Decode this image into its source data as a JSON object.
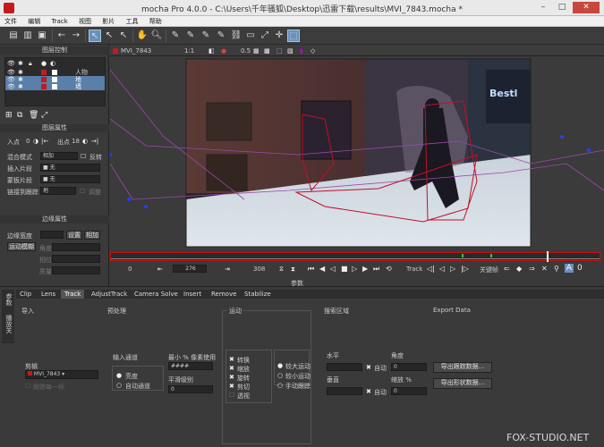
{
  "window": {
    "title": "mocha Pro 4.0.0 - C:\\Users\\千年骚狐\\Desktop\\迅雷下载\\results\\MVI_7843.mocha *"
  },
  "menu": [
    "文件",
    "编辑",
    "Track",
    "视图",
    "影片",
    "工具",
    "帮助"
  ],
  "layers_panel": {
    "title": "图层控制",
    "layers": [
      {
        "name": "人物"
      },
      {
        "name": "地"
      },
      {
        "name": "墙"
      }
    ]
  },
  "layer_props": {
    "title": "图层属性",
    "in_label": "入点",
    "in_value": "0",
    "out_label": "出点",
    "out_value": "18",
    "blend_label": "混合模式",
    "blend_value": "相加",
    "invert_label": "反转",
    "insert_clip_label": "插入片段",
    "insert_clip_value": "无",
    "matte_clip_label": "蒙板片段",
    "matte_clip_value": "无",
    "link_track_label": "链接到跟踪",
    "link_track_value": "地",
    "link_extra": "调整"
  },
  "edge_props": {
    "title": "边缘属性",
    "edge_width_label": "边缘宽度",
    "set_label": "设置",
    "add_label": "相加",
    "motion_blur_label": "运动模糊",
    "angle_label": "角度",
    "phase_label": "相位",
    "quality_label": "质量"
  },
  "viewer": {
    "clip_name": "MVI_7843",
    "zoom": "1:1",
    "alpha": "0.5"
  },
  "timeline": {
    "start": "0",
    "current": "276",
    "end": "308",
    "track_label": "Track",
    "keyframe_label": "关键帧",
    "params_label": "参数"
  },
  "tabs": [
    "Clip",
    "Lens",
    "Track",
    "AdjustTrack",
    "Camera Solve",
    "Insert",
    "Remove",
    "Stabilize"
  ],
  "active_tab": "Track",
  "side_tabs": [
    "参数",
    "播放关"
  ],
  "track_panel": {
    "input_title": "导入",
    "clip_label": "剪辑",
    "clip_value": "MVI_7843",
    "track_each_frame": "跟踪每一帧",
    "preprocess_title": "预处理",
    "input_channel_label": "输入通道",
    "luminance": "亮度",
    "auto_channel": "自动通道",
    "min_pixels_label": "最小 % 像素使用",
    "min_pixels_value": "####",
    "smooth_label": "平滑级别",
    "smooth_value": "0",
    "motion_title": "运动",
    "motion_items": [
      "转换",
      "缩放",
      "旋转",
      "剪切",
      "透视"
    ],
    "motion_modes": [
      "较大运动",
      "较小运动",
      "手动跟踪"
    ],
    "search_title": "搜索区域",
    "horizontal_label": "水平",
    "vertical_label": "垂直",
    "angle_label": "角度",
    "zoom_label": "缩放 %",
    "auto_label": "自动",
    "angle_value": "0",
    "zoom_value": "0",
    "export_title": "Export Data",
    "export_track": "导出跟踪数据...",
    "export_shape": "导出形状数据..."
  },
  "watermark": "FOX-STUDIO.NET",
  "colors": {
    "accent": "#6a8fbf",
    "spline": "#c0102a",
    "spline2": "#9a4aa8",
    "timeline_red": "#cc1010"
  }
}
